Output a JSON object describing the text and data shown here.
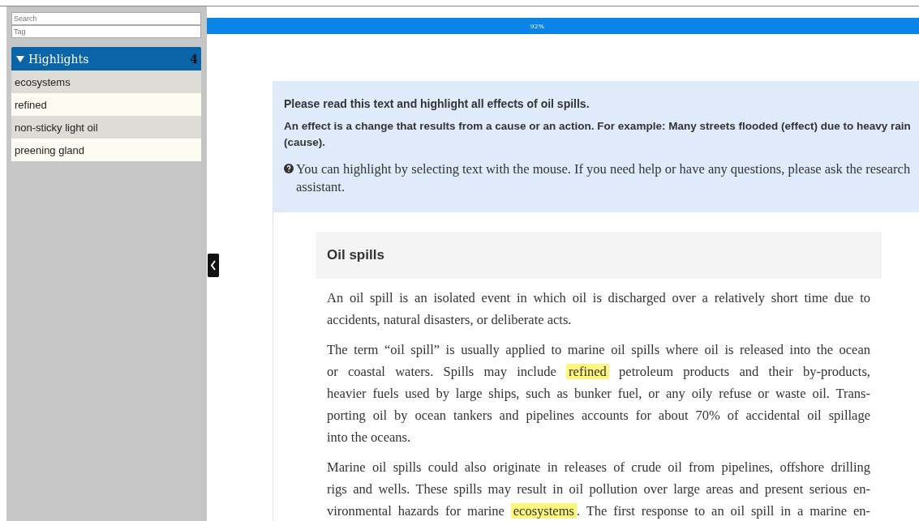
{
  "sidebar": {
    "search": {
      "placeholder": "Search"
    },
    "tag": {
      "placeholder": "Tag"
    },
    "highlights": {
      "title": "Highlights",
      "expanded": true,
      "count": "4",
      "items": [
        {
          "label": "ecosystems"
        },
        {
          "label": "refined"
        },
        {
          "label": "non-sticky light oil"
        },
        {
          "label": "preening gland"
        }
      ]
    }
  },
  "progress": {
    "level": 0.92,
    "reading": "92%"
  },
  "instructions": {
    "title": "Please read this text and highlight all effects of oil spills.",
    "definition": "An effect is a change that results from a cause or an action. For example: Many streets flooded (effect) due to heavy rain (cause).",
    "help": "You can highlight by selecting text with the mouse. If you need help or have any questions, please ask the research assistant."
  },
  "article": {
    "title": "Oil spills",
    "paragraphs": [
      [
        [
          {
            "text": "An oil spill is an isolated event in which oil is discharged over a relatively short time due to",
            "highlighted": false
          }
        ],
        [
          {
            "text": "accidents, natural disasters, or deliberate acts.",
            "highlighted": false
          }
        ]
      ],
      [
        [
          {
            "text": "The term “oil spill” is usually applied to marine oil spills where oil is released into the ocean",
            "highlighted": false
          }
        ],
        [
          {
            "text": "or coastal waters. Spills may include",
            "highlighted": false
          },
          {
            "text": "refined",
            "highlighted": true
          },
          {
            "text": "petroleum products and their by-products,",
            "highlighted": false
          }
        ],
        [
          {
            "text": "heavier fuels used by large ships, such as bunker fuel, or any oily refuse or waste oil. Trans-",
            "highlighted": false
          }
        ],
        [
          {
            "text": "porting oil by ocean tankers and pipelines accounts for about 70% of accidental oil spillage",
            "highlighted": false
          }
        ],
        [
          {
            "text": "into the oceans.",
            "highlighted": false
          }
        ]
      ],
      [
        [
          {
            "text": "Marine oil spills could also originate in releases of crude oil from pipelines, offshore drilling",
            "highlighted": false
          }
        ],
        [
          {
            "text": "rigs and wells. These spills may result in oil pollution over large areas and present serious en-",
            "highlighted": false
          }
        ],
        [
          {
            "text": "vironmental hazards for marine",
            "highlighted": false
          },
          {
            "text": "ecosystems",
            "highlighted": true
          },
          {
            "text": ". The first response to an oil spill in a marine en-",
            "highlighted": false
          }
        ]
      ]
    ]
  }
}
